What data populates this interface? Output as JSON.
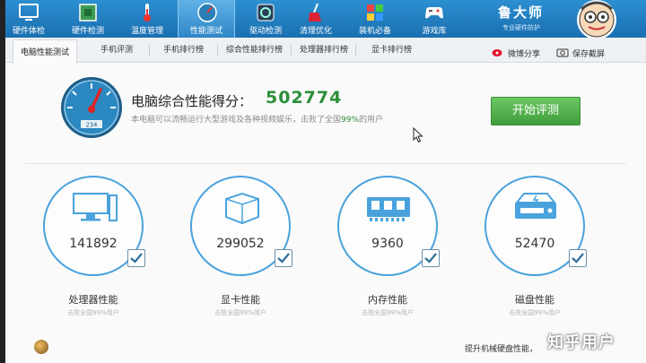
{
  "toolbar": {
    "items": [
      {
        "label": "硬件体检",
        "icon": "monitor-icon"
      },
      {
        "label": "硬件检测",
        "icon": "circuit-board-icon"
      },
      {
        "label": "温度管理",
        "icon": "thermometer-icon"
      },
      {
        "label": "性能测试",
        "icon": "speedometer-icon",
        "active": true
      },
      {
        "label": "驱动检测",
        "icon": "gear-box-icon"
      },
      {
        "label": "清理优化",
        "icon": "broom-icon"
      },
      {
        "label": "装机必备",
        "icon": "cube-icon"
      },
      {
        "label": "游戏库",
        "icon": "gamepad-icon"
      }
    ],
    "brand": "鲁大师",
    "brand_sub": "专业硬件防护"
  },
  "tabs": {
    "items": [
      "电脑性能测试",
      "手机评测",
      "手机排行榜",
      "综合性能排行榜",
      "处理器排行榜",
      "显卡排行榜"
    ],
    "share_weibo": "微博分享",
    "save_screenshot": "保存截屏"
  },
  "score": {
    "title": "电脑综合性能得分：",
    "value": "502774",
    "desc_prefix": "本电脑可以流畅运行大型游戏及各种视频娱乐，击败了全国",
    "desc_percent": "99%",
    "desc_suffix": "的用户",
    "gauge_reading": "234",
    "start_button": "开始评测"
  },
  "metrics": [
    {
      "name": "处理器性能",
      "value": "141892",
      "sub": "击败全国99%用户",
      "icon": "cpu-monitor-icon"
    },
    {
      "name": "显卡性能",
      "value": "299052",
      "sub": "击败全国99%用户",
      "icon": "gpu-cube-icon"
    },
    {
      "name": "内存性能",
      "value": "9360",
      "sub": "击败全国99%用户",
      "icon": "memory-chip-icon"
    },
    {
      "name": "磁盘性能",
      "value": "52470",
      "sub": "击败全国99%用户",
      "icon": "hard-disk-icon"
    }
  ],
  "bottom": {
    "tip": "提升机械硬盘性能，",
    "watermark": "知乎用户"
  },
  "colors": {
    "toolbar_blue": "#1a6fb0",
    "score_green": "#2a8f38",
    "ring_blue": "#4aa2dd",
    "button_green": "#4fae48"
  }
}
